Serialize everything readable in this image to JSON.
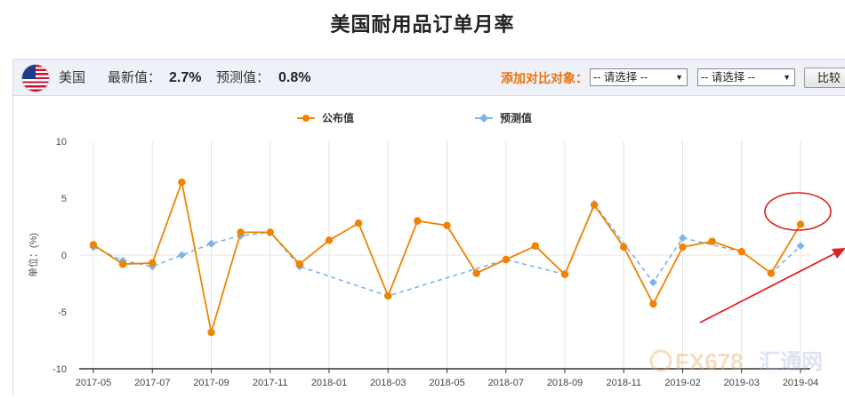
{
  "page": {
    "title": "美国耐用品订单月率"
  },
  "toolbar": {
    "country": "美国",
    "latest_label": "最新值：",
    "latest_value": "2.7%",
    "forecast_label": "预测值：",
    "forecast_value": "0.8%",
    "compare_label": "添加对比对象：",
    "select1_value": "-- 请选择 --",
    "select2_value": "-- 请选择 --",
    "compare_button": "比较"
  },
  "watermark": {
    "text": "FX678",
    "text2": "汇通网"
  },
  "colors": {
    "published": "#f08300",
    "forecast": "#7cb5ec",
    "annotation": "#e02020"
  },
  "chart_data": {
    "type": "line",
    "ylabel": "单位：(%)",
    "ylim": [
      -10,
      10
    ],
    "yticks": [
      10,
      5,
      0,
      -5,
      -10
    ],
    "x_tick_labels": [
      "2017-05",
      "2017-07",
      "2017-09",
      "2017-11",
      "2018-01",
      "2018-03",
      "2018-05",
      "2018-07",
      "2018-09",
      "2018-11",
      "2019-02",
      "2019-03",
      "2019-04"
    ],
    "legend_position": "top-center",
    "series": [
      {
        "name": "公布值",
        "style": "solid",
        "values": [
          0.9,
          -0.8,
          -0.7,
          6.4,
          -6.8,
          2.0,
          2.0,
          -0.8,
          1.3,
          2.8,
          -3.6,
          3.0,
          2.6,
          -1.6,
          -0.4,
          0.8,
          -1.7,
          4.4,
          0.7,
          -4.3,
          0.7,
          1.2,
          0.3,
          -1.6,
          2.7
        ]
      },
      {
        "name": "预测值",
        "style": "dashed",
        "values": [
          0.7,
          -0.5,
          -1.0,
          0.0,
          1.0,
          1.7,
          2.0,
          -1.0,
          null,
          null,
          -3.6,
          null,
          null,
          null,
          -0.4,
          null,
          -1.7,
          4.5,
          null,
          -2.4,
          1.5,
          null,
          0.3,
          -1.6,
          0.8
        ]
      }
    ]
  }
}
